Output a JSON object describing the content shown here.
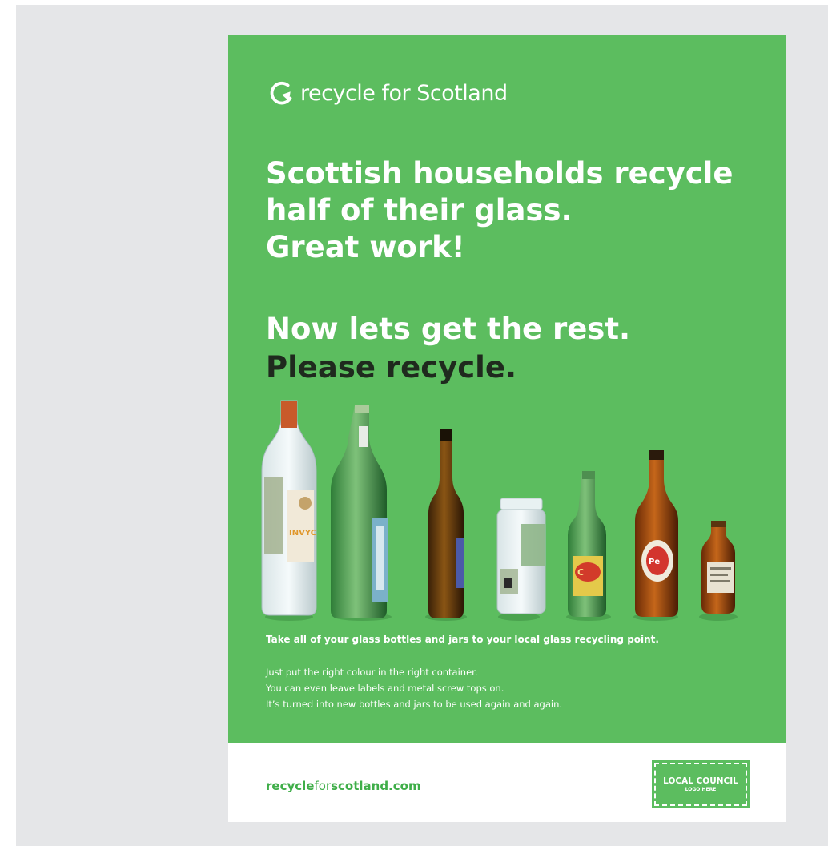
{
  "brand": {
    "icon": "recycle-arrow-icon",
    "name": "recycle for Scotland"
  },
  "headline": {
    "lines": [
      "Scottish households recycle",
      "half of their glass.",
      "Great work!"
    ]
  },
  "callout": {
    "line1": "Now lets get the rest.",
    "line2": "Please recycle."
  },
  "bottles": {
    "items": [
      {
        "name": "clear-wine-bottle",
        "label": "INVYC"
      },
      {
        "name": "green-wine-bottle",
        "label": ""
      },
      {
        "name": "brown-sauce-bottle",
        "label": ""
      },
      {
        "name": "clear-jar",
        "label": ""
      },
      {
        "name": "green-beer-bottle",
        "label": ""
      },
      {
        "name": "brown-beer-bottle",
        "label": ""
      },
      {
        "name": "small-brown-bottle",
        "label": ""
      }
    ]
  },
  "instructions": {
    "bold": "Take all of your glass bottles and jars to your local glass recycling point.",
    "lines": [
      "Just put the right colour in the right container.",
      "You can even leave labels and metal screw tops on.",
      "It’s turned into new bottles and jars to be used again and again."
    ]
  },
  "footer": {
    "url_part1": "recycle",
    "url_part2": "for",
    "url_part3": "scotland.com",
    "council_title": "LOCAL COUNCIL",
    "council_subtitle": "LOGO HERE"
  },
  "colors": {
    "poster_green": "#5cbd5f",
    "canvas_grey": "#e5e6e8",
    "url_green": "#3fae49",
    "callout_dark": "#1f2a1e"
  }
}
